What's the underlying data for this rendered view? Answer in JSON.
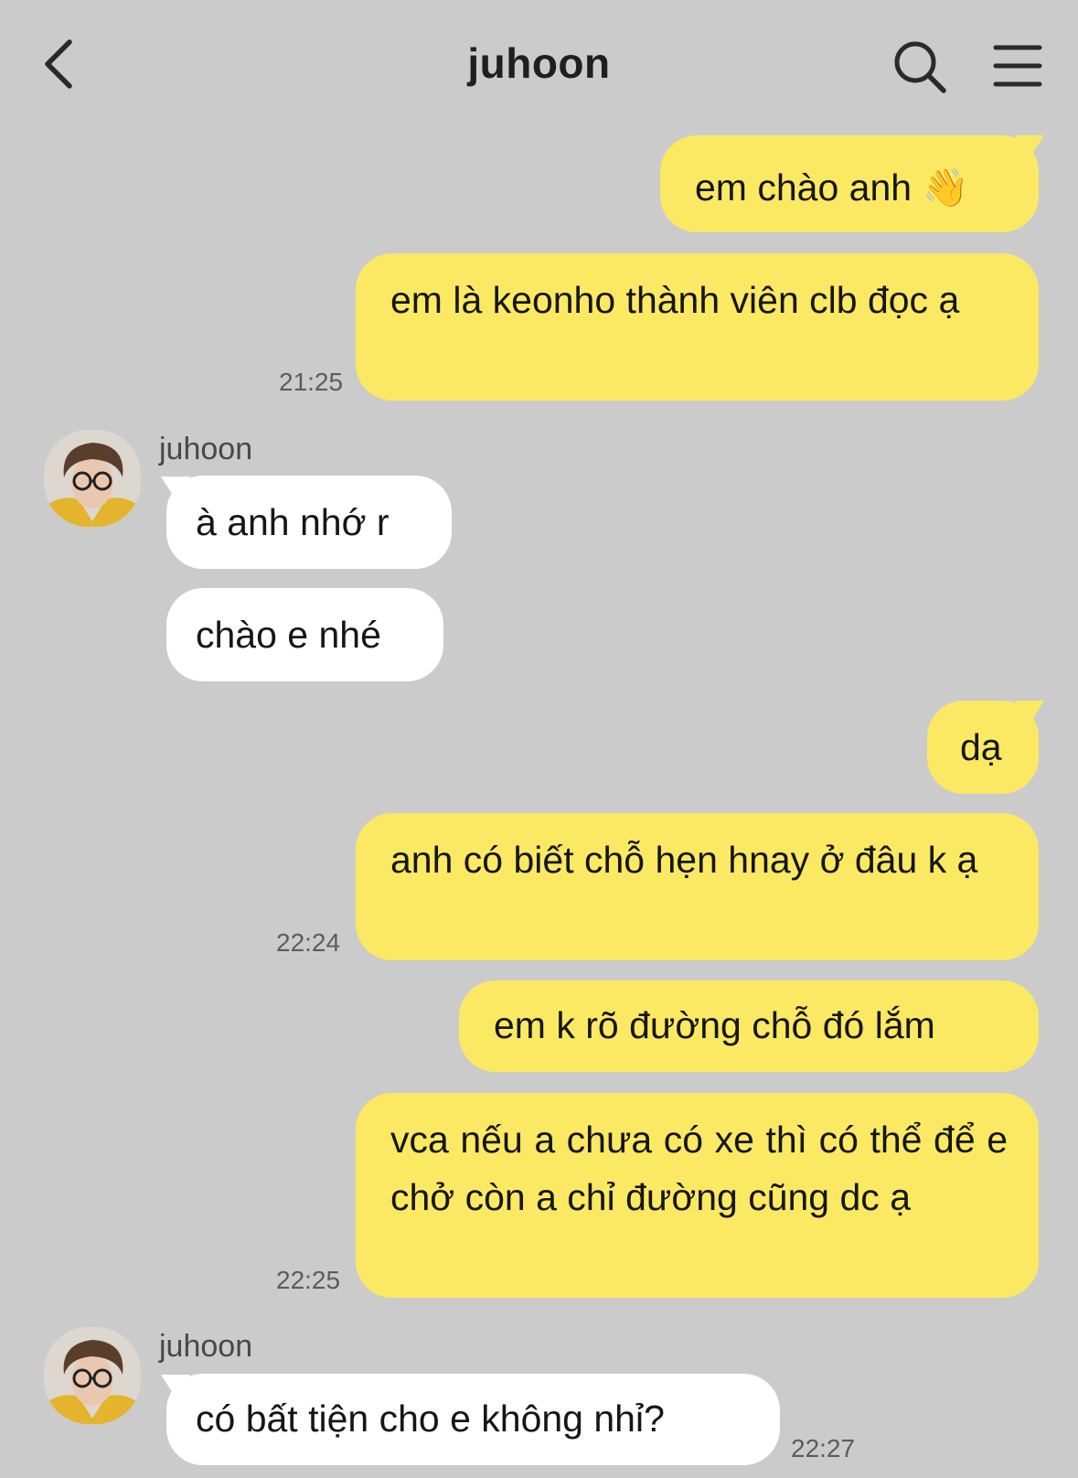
{
  "header": {
    "title": "juhoon"
  },
  "messages": [
    {
      "side": "me",
      "text": "em chào anh 👋"
    },
    {
      "side": "me",
      "text": "em là keonho thành viên clb đọc ạ",
      "time": "21:25"
    },
    {
      "side": "them",
      "sender": "juhoon",
      "text": "à anh nhớ r"
    },
    {
      "side": "them",
      "text": "chào e nhé"
    },
    {
      "side": "me",
      "text": "dạ"
    },
    {
      "side": "me",
      "text": "anh có biết chỗ hẹn hnay ở đâu k ạ",
      "time": "22:24"
    },
    {
      "side": "me",
      "text": "em k rõ đường chỗ đó lắm"
    },
    {
      "side": "me",
      "text": "vca nếu a chưa có xe thì có thể để e chở còn a chỉ đường cũng dc ạ",
      "time": "22:25"
    },
    {
      "side": "them",
      "sender": "juhoon",
      "text": "có bất tiện cho e không nhỉ?",
      "time": "22:27"
    }
  ],
  "colors": {
    "background": "#cbcbcb",
    "my_bubble": "#fbe964",
    "their_bubble": "#ffffff"
  },
  "icons": {
    "back": "chevron-left-icon",
    "search": "search-icon",
    "menu": "hamburger-menu-icon"
  }
}
